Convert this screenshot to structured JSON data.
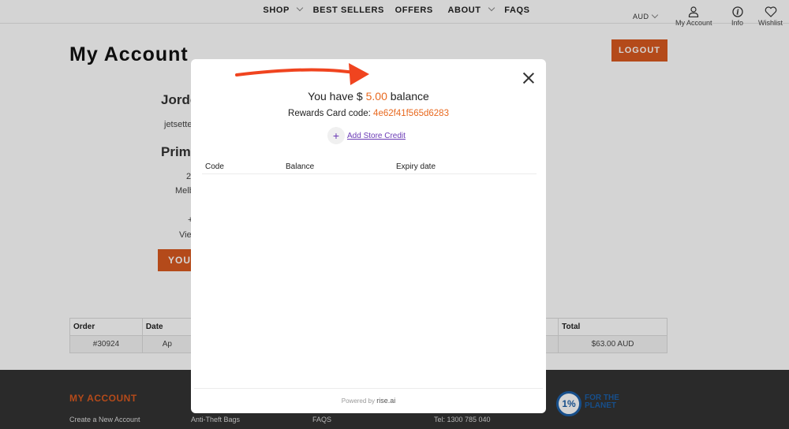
{
  "nav": {
    "menu": [
      {
        "label": "SHOP",
        "dropdown": true
      },
      {
        "label": "BEST SELLERS",
        "dropdown": false
      },
      {
        "label": "OFFERS",
        "dropdown": false
      },
      {
        "label": "ABOUT",
        "dropdown": true
      },
      {
        "label": "FAQS",
        "dropdown": false
      }
    ],
    "currency": "AUD",
    "account_label": "My Account",
    "info_label": "Info",
    "wishlist_label": "Wishlist"
  },
  "page": {
    "title": "My Account",
    "logout_label": "LOGOUT",
    "customer_name": "Jorde",
    "email": "jetsette",
    "address_title": "Prime",
    "address_line1": "2",
    "address_line2": "Melb",
    "address_line3": "+",
    "view_addresses": "Vie",
    "addresses_button": "YOUR"
  },
  "orders": {
    "headers": [
      "Order",
      "Date",
      "Total"
    ],
    "rows": [
      {
        "order": "#30924",
        "date": "Ap",
        "total": "$63.00 AUD"
      }
    ]
  },
  "footer": {
    "heading": "MY ACCOUNT",
    "links": [
      "Create a New Account",
      "Anti-Theft Bags",
      "FAQS",
      "Tel: 1300 785 040"
    ],
    "badge_number": "1%",
    "badge_text_1": "FOR THE",
    "badge_text_2": "PLANET"
  },
  "modal": {
    "balance_prefix": "You have $ ",
    "balance_amount": "5.00",
    "balance_suffix": " balance",
    "code_prefix": "Rewards Card code: ",
    "code_value": "4e62f41f565d6283",
    "add_credit_label": "Add Store Credit",
    "columns": [
      "Code",
      "Balance",
      "Expiry date"
    ],
    "powered_by": "Powered by",
    "brand": "rise.ai"
  },
  "colors": {
    "accent": "#d95a20",
    "balance": "#e8691f",
    "link": "#6a3ab5",
    "arrow": "#f0441f"
  }
}
